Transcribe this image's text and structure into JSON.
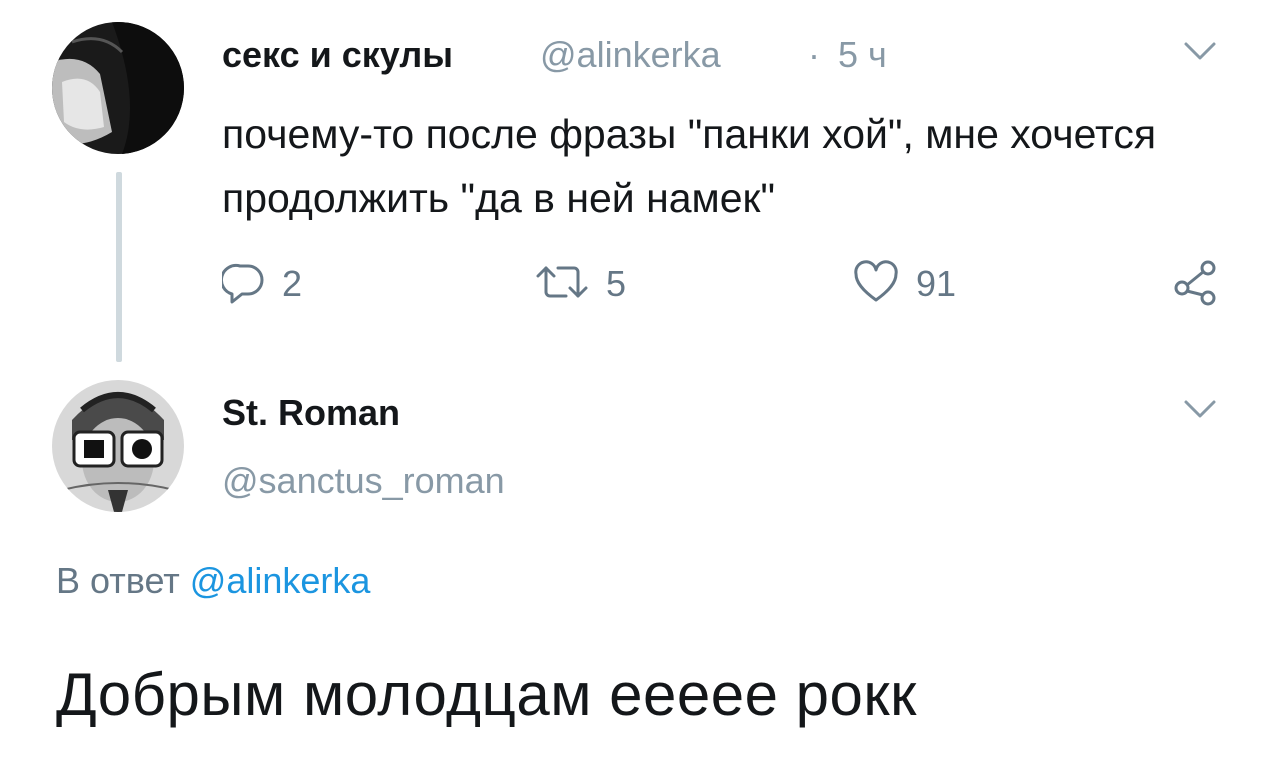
{
  "tweet1": {
    "display_name": "секс и скулы",
    "handle": "@alinkerka",
    "separator": "·",
    "time": "5 ч",
    "text": "почему-то после фразы \"панки хой\", мне хочется продолжить \"да в ней намек\"",
    "actions": {
      "reply_count": "2",
      "retweet_count": "5",
      "like_count": "91"
    },
    "icons": [
      "avatar",
      "chevron-down-icon",
      "reply-icon",
      "retweet-icon",
      "like-icon",
      "share-icon"
    ]
  },
  "tweet2": {
    "display_name": "St. Roman",
    "handle": "@sanctus_roman",
    "reply_prefix": "В ответ",
    "reply_mention": "@alinkerka",
    "text": "Добрым молодцам еееее рокк",
    "icons": [
      "avatar",
      "chevron-down-icon"
    ]
  },
  "colors": {
    "text": "#14171a",
    "muted": "#8899a6",
    "link": "#1b95e0",
    "thread_line": "#cfd9de"
  }
}
